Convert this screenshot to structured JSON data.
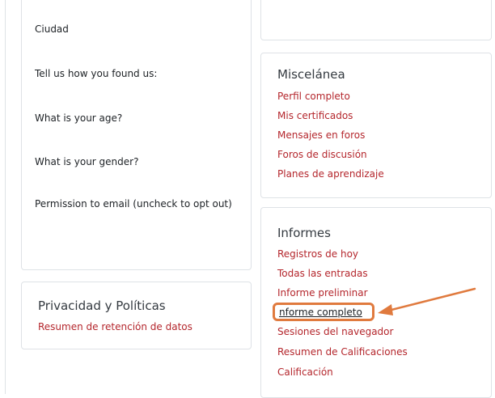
{
  "profile_fields": [
    "Ciudad",
    "Tell us how you found us:",
    "What is your age?",
    "What is your gender?",
    "Permission to email (uncheck to opt out)"
  ],
  "misc": {
    "title": "Miscelánea",
    "links": [
      "Perfil completo",
      "Mis certificados",
      "Mensajes en foros",
      "Foros de discusión",
      "Planes de aprendizaje"
    ]
  },
  "privacy": {
    "title": "Privacidad y Políticas",
    "links": [
      "Resumen de retención de datos"
    ]
  },
  "reports": {
    "title": "Informes",
    "links": [
      "Registros de hoy",
      "Todas las entradas",
      "Informe preliminar",
      "nforme completo",
      "Sesiones del navegador",
      "Resumen de Calificaciones",
      "Calificación"
    ]
  },
  "colors": {
    "link": "#b4262c",
    "highlight": "#e07a3e",
    "border": "#dee2e6"
  }
}
